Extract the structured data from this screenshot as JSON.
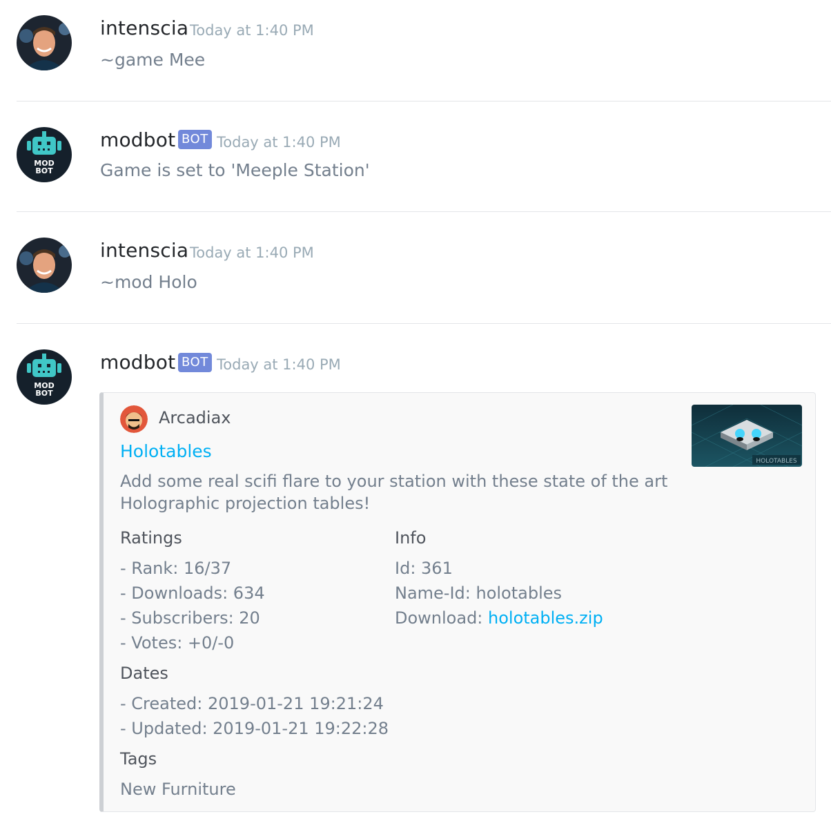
{
  "messages": [
    {
      "author": "intenscia",
      "bot": false,
      "timestamp": "Today at 1:40 PM",
      "content": "~game Mee",
      "avatar": "user-avatar"
    },
    {
      "author": "modbot",
      "bot": true,
      "badge": "BOT",
      "timestamp": "Today at 1:40 PM",
      "content": "Game is set to 'Meeple Station'",
      "avatar": "modbot-avatar"
    },
    {
      "author": "intenscia",
      "bot": false,
      "timestamp": "Today at 1:40 PM",
      "content": "~mod Holo",
      "avatar": "user-avatar"
    },
    {
      "author": "modbot",
      "bot": true,
      "badge": "BOT",
      "timestamp": "Today at 1:40 PM",
      "content": "",
      "avatar": "modbot-avatar"
    }
  ],
  "modbot_avatar_text": [
    "MOD",
    "BOT"
  ],
  "thumbnail_text": "HOLOTABLES",
  "embed": {
    "author": "Arcadiax",
    "title": "Holotables",
    "description_lines": [
      "Add some real scifi flare to your station with these state of the art",
      "Holographic projection tables!"
    ],
    "fields": {
      "ratings": {
        "name": "Ratings",
        "lines": [
          "- Rank: 16/37",
          "- Downloads: 634",
          "- Subscribers: 20",
          "- Votes: +0/-0"
        ]
      },
      "info": {
        "name": "Info",
        "id": "Id: 361",
        "name_id": "Name-Id: holotables",
        "download_label": "Download: ",
        "download_link": "holotables.zip"
      },
      "dates": {
        "name": "Dates",
        "lines": [
          "- Created: 2019-01-21 19:21:24",
          "- Updated: 2019-01-21 19:22:28"
        ]
      },
      "tags": {
        "name": "Tags",
        "value": "New Furniture"
      }
    }
  },
  "colors": {
    "accent_link": "#00b0f4",
    "bot_badge": "#7289da",
    "embed_border": "#cdd0d4"
  }
}
